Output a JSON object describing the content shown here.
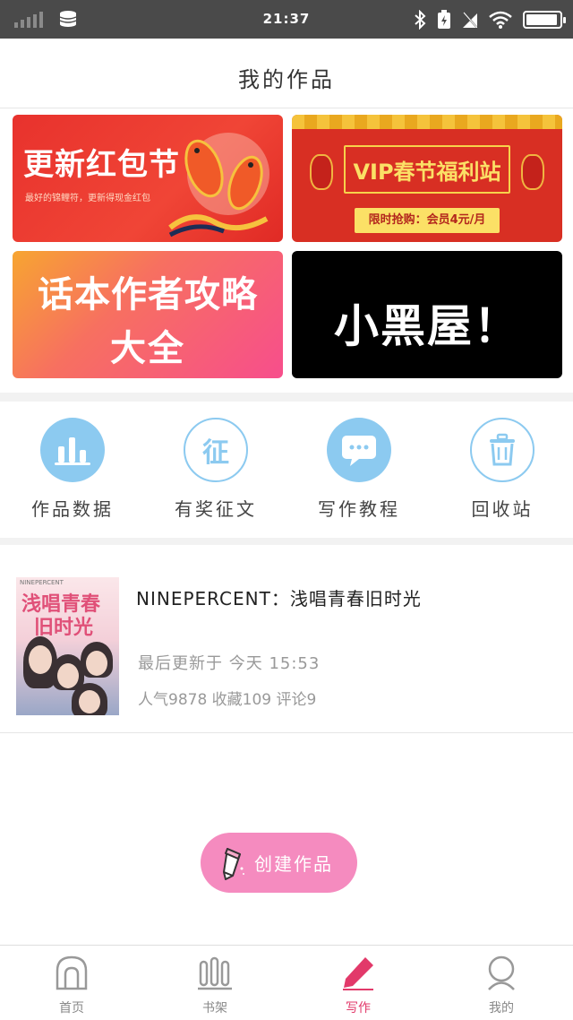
{
  "status_bar": {
    "time": "21:37",
    "battery_level": 0.95
  },
  "header": {
    "title": "我的作品"
  },
  "banners": [
    {
      "big": "更新红包节",
      "sub": "最好的锦鲤符，更新得现金红包"
    },
    {
      "big": "VIP春节福利站",
      "promo": "限时抢购：会员4元/月"
    },
    {
      "line1": "话本作者攻略",
      "line2": "大全"
    },
    {
      "big": "小黑屋！"
    }
  ],
  "actions": [
    {
      "label": "作品数据",
      "icon": "bar-chart-icon"
    },
    {
      "label": "有奖征文",
      "icon": "zheng-icon",
      "glyph": "征"
    },
    {
      "label": "写作教程",
      "icon": "chat-bubble-icon"
    },
    {
      "label": "回收站",
      "icon": "trash-icon"
    }
  ],
  "work": {
    "cover": {
      "tag": "NINEPERCENT",
      "line1": "浅唱青春",
      "line2": "旧时光"
    },
    "title": "NINEPERCENT：浅唱青春旧时光",
    "updated": "最后更新于 今天 15:53",
    "stats": "人气9878 收藏109 评论9"
  },
  "create_button": {
    "label": "创建作品"
  },
  "tabbar": [
    {
      "label": "首页",
      "icon": "home-icon"
    },
    {
      "label": "书架",
      "icon": "bookshelf-icon"
    },
    {
      "label": "写作",
      "icon": "pencil-icon",
      "active": true
    },
    {
      "label": "我的",
      "icon": "profile-icon"
    }
  ],
  "colors": {
    "accent": "#e2396a",
    "action_blue": "#8ccaf0",
    "create_pink": "#f58bbf"
  }
}
